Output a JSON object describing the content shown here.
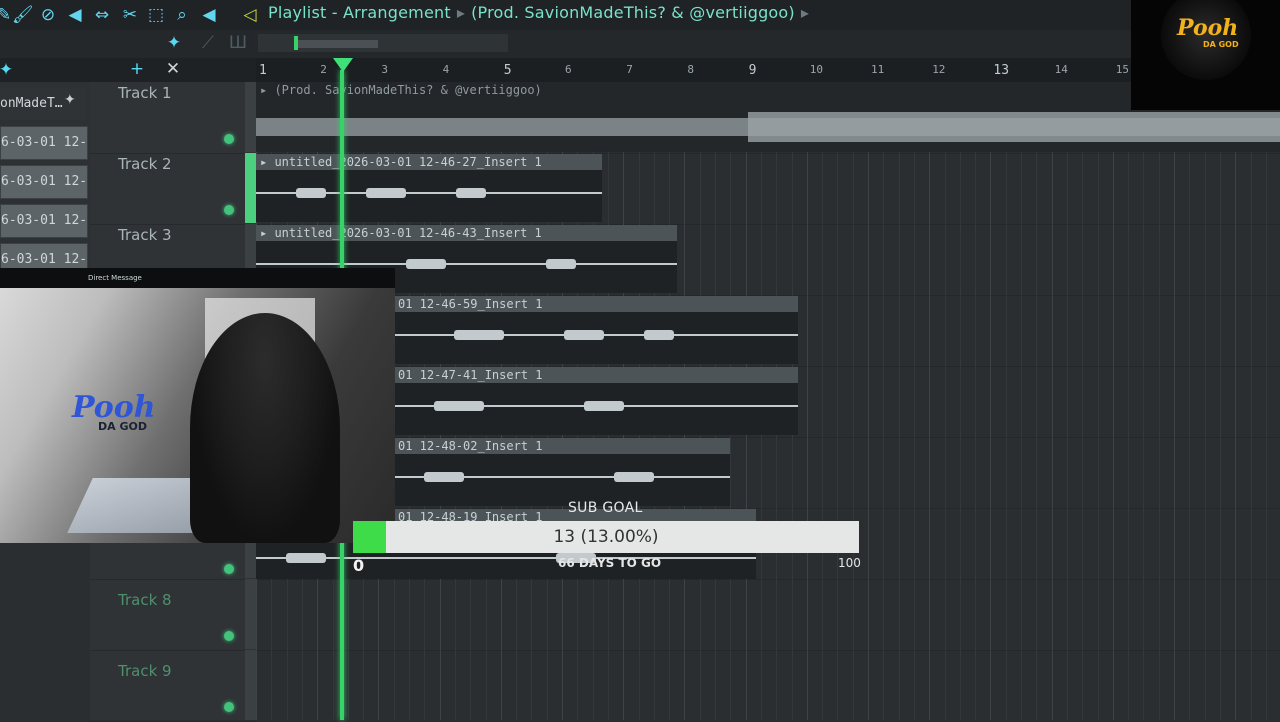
{
  "toolbar": {
    "icons": [
      "pencil-icon",
      "paint-icon",
      "delete-icon",
      "mute-icon",
      "slip-icon",
      "slice-icon",
      "select-icon",
      "zoom-icon",
      "playback-icon"
    ],
    "playlist_icon": "speaker-icon"
  },
  "breadcrumb": {
    "title": "Playlist - Arrangement",
    "pattern": "(Prod. SavionMadeThis? & @vertiiggoo)"
  },
  "ruler": {
    "bars": [
      "1",
      "2",
      "3",
      "4",
      "5",
      "6",
      "7",
      "8",
      "9",
      "10",
      "11",
      "12",
      "13",
      "14",
      "15"
    ]
  },
  "left_clips": [
    "onMadeT…",
    "6-03-01 12-…",
    "6-03-01 12-…",
    "6-03-01 12-…",
    "6-03-01 12-…"
  ],
  "tracks": [
    {
      "name": "Track 1"
    },
    {
      "name": "Track 2"
    },
    {
      "name": "Track 3"
    },
    {
      "name": ""
    },
    {
      "name": ""
    },
    {
      "name": ""
    },
    {
      "name": ""
    },
    {
      "name": "Track 8"
    },
    {
      "name": "Track 9"
    }
  ],
  "clips": {
    "master": "(Prod. SavionMadeThis? & @vertiiggoo)",
    "c1": "untitled_2026-03-01 12-46-27_Insert 1",
    "c2": "untitled_2026-03-01 12-46-43_Insert 1",
    "c3": "01 12-46-59_Insert 1",
    "c4": "01 12-47-41_Insert 1",
    "c5": "01 12-48-02_Insert 1",
    "c6": "01 12-48-19_Insert 1"
  },
  "webcam": {
    "title": "Direct Message",
    "overlay_logo": "Pooh",
    "overlay_sub": "DA GOD"
  },
  "sub_goal": {
    "title": "SUB GOAL",
    "text": "13 (13.00%)",
    "progress": 0.13,
    "min": "0",
    "max": "100",
    "days": "66 DAYS TO GO",
    "fill_color": "#3fdc4a"
  },
  "corner_logo": {
    "text": "Pooh",
    "sub": "DA GOD",
    "color": "#f2b21b"
  },
  "colors": {
    "accent": "#79e3c9",
    "playhead": "#37d36a"
  }
}
